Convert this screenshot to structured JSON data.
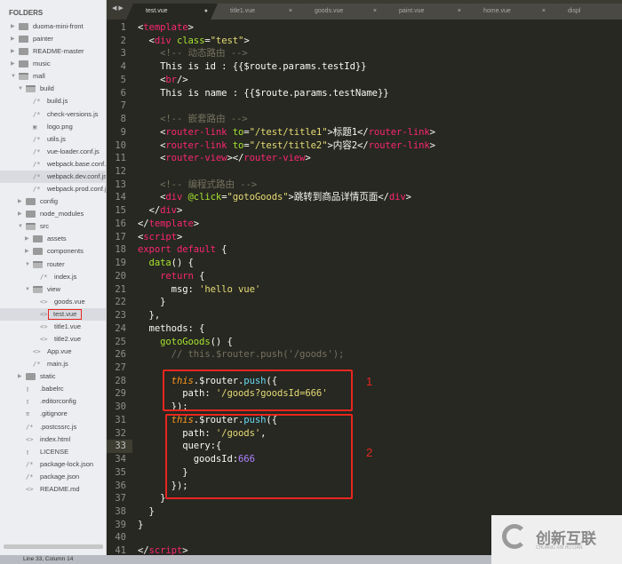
{
  "sidebar": {
    "title": "FOLDERS",
    "items": [
      {
        "depth": 0,
        "type": "folder-closed",
        "label": "duoma-mini-front"
      },
      {
        "depth": 0,
        "type": "folder-closed",
        "label": "painter"
      },
      {
        "depth": 0,
        "type": "folder-closed",
        "label": "README-master"
      },
      {
        "depth": 0,
        "type": "folder-closed",
        "label": "music"
      },
      {
        "depth": 0,
        "type": "folder-open",
        "label": "mall"
      },
      {
        "depth": 1,
        "type": "folder-open",
        "label": "build"
      },
      {
        "depth": 2,
        "type": "js",
        "label": "build.js"
      },
      {
        "depth": 2,
        "type": "js",
        "label": "check-versions.js"
      },
      {
        "depth": 2,
        "type": "img",
        "label": "logo.png"
      },
      {
        "depth": 2,
        "type": "js",
        "label": "utils.js"
      },
      {
        "depth": 2,
        "type": "js",
        "label": "vue-loader.conf.js"
      },
      {
        "depth": 2,
        "type": "js",
        "label": "webpack.base.conf.js"
      },
      {
        "depth": 2,
        "type": "js",
        "label": "webpack.dev.conf.js",
        "selected": true
      },
      {
        "depth": 2,
        "type": "js",
        "label": "webpack.prod.conf.js"
      },
      {
        "depth": 1,
        "type": "folder-closed",
        "label": "config"
      },
      {
        "depth": 1,
        "type": "folder-closed",
        "label": "node_modules"
      },
      {
        "depth": 1,
        "type": "folder-open",
        "label": "src"
      },
      {
        "depth": 2,
        "type": "folder-closed",
        "label": "assets"
      },
      {
        "depth": 2,
        "type": "folder-closed",
        "label": "components"
      },
      {
        "depth": 2,
        "type": "folder-open",
        "label": "router"
      },
      {
        "depth": 3,
        "type": "js",
        "label": "index.js"
      },
      {
        "depth": 2,
        "type": "folder-open",
        "label": "view"
      },
      {
        "depth": 3,
        "type": "vue",
        "label": "goods.vue"
      },
      {
        "depth": 3,
        "type": "vue",
        "label": "test.vue",
        "selected": true,
        "highlighted": true
      },
      {
        "depth": 3,
        "type": "vue",
        "label": "title1.vue"
      },
      {
        "depth": 3,
        "type": "vue",
        "label": "title2.vue"
      },
      {
        "depth": 2,
        "type": "vue",
        "label": "App.vue"
      },
      {
        "depth": 2,
        "type": "js",
        "label": "main.js"
      },
      {
        "depth": 1,
        "type": "folder-closed",
        "label": "static"
      },
      {
        "depth": 1,
        "type": "file",
        "label": ".babelrc"
      },
      {
        "depth": 1,
        "type": "file",
        "label": ".editorconfig"
      },
      {
        "depth": 1,
        "type": "list",
        "label": ".gitignore"
      },
      {
        "depth": 1,
        "type": "js",
        "label": ".postcssrc.js"
      },
      {
        "depth": 1,
        "type": "vue",
        "label": "index.html"
      },
      {
        "depth": 1,
        "type": "file",
        "label": "LICENSE"
      },
      {
        "depth": 1,
        "type": "js",
        "label": "package-lock.json"
      },
      {
        "depth": 1,
        "type": "js",
        "label": "package.json"
      },
      {
        "depth": 1,
        "type": "vue",
        "label": "README.md"
      }
    ]
  },
  "tabs": [
    {
      "label": "test.vue",
      "active": true,
      "modified": true
    },
    {
      "label": "title1.vue"
    },
    {
      "label": "goods.vue"
    },
    {
      "label": "paint.vue"
    },
    {
      "label": "home.vue"
    },
    {
      "label": "displ"
    }
  ],
  "editor": {
    "current_line": 33,
    "lines": [
      [
        [
          "p",
          "<"
        ],
        [
          "tag",
          "template"
        ],
        [
          "p",
          ">"
        ]
      ],
      [
        [
          "p",
          "  <"
        ],
        [
          "tag",
          "div "
        ],
        [
          "attr",
          "class"
        ],
        [
          "p",
          "="
        ],
        [
          "str",
          "\"test\""
        ],
        [
          "p",
          ">"
        ]
      ],
      [
        [
          "cm",
          "    <!-- 动态路由 -->"
        ]
      ],
      [
        [
          "p",
          "    This is id : {{$route.params.testId}}"
        ]
      ],
      [
        [
          "p",
          "    <"
        ],
        [
          "tag",
          "br"
        ],
        [
          "p",
          "/>"
        ]
      ],
      [
        [
          "p",
          "    This is name : {{$route.params.testName}}"
        ]
      ],
      [],
      [
        [
          "cm",
          "    <!-- 嵌套路由 -->"
        ]
      ],
      [
        [
          "p",
          "    <"
        ],
        [
          "tag",
          "router-link "
        ],
        [
          "attr",
          "to"
        ],
        [
          "p",
          "="
        ],
        [
          "str",
          "\"/test/title1\""
        ],
        [
          "p",
          ">标题1</"
        ],
        [
          "tag",
          "router-link"
        ],
        [
          "p",
          ">"
        ]
      ],
      [
        [
          "p",
          "    <"
        ],
        [
          "tag",
          "router-link "
        ],
        [
          "attr",
          "to"
        ],
        [
          "p",
          "="
        ],
        [
          "str",
          "\"/test/title2\""
        ],
        [
          "p",
          ">内容2</"
        ],
        [
          "tag",
          "router-link"
        ],
        [
          "p",
          ">"
        ]
      ],
      [
        [
          "p",
          "    <"
        ],
        [
          "tag",
          "router-view"
        ],
        [
          "p",
          "></"
        ],
        [
          "tag",
          "router-view"
        ],
        [
          "p",
          ">"
        ]
      ],
      [],
      [
        [
          "cm",
          "    <!-- 编程式路由 -->"
        ]
      ],
      [
        [
          "p",
          "    <"
        ],
        [
          "tag",
          "div "
        ],
        [
          "attr",
          "@click"
        ],
        [
          "p",
          "="
        ],
        [
          "str",
          "\"gotoGoods\""
        ],
        [
          "p",
          ">跳转到商品详情页面</"
        ],
        [
          "tag",
          "div"
        ],
        [
          "p",
          ">"
        ]
      ],
      [
        [
          "p",
          "  </"
        ],
        [
          "tag",
          "div"
        ],
        [
          "p",
          ">"
        ]
      ],
      [
        [
          "p",
          "</"
        ],
        [
          "tag",
          "template"
        ],
        [
          "p",
          ">"
        ]
      ],
      [
        [
          "p",
          "<"
        ],
        [
          "tag",
          "script"
        ],
        [
          "p",
          ">"
        ]
      ],
      [
        [
          "kw",
          "export default "
        ],
        [
          "p",
          "{"
        ]
      ],
      [
        [
          "fn",
          "  data"
        ],
        [
          "p",
          "() {"
        ]
      ],
      [
        [
          "kw",
          "    return "
        ],
        [
          "p",
          "{"
        ]
      ],
      [
        [
          "p",
          "      msg: "
        ],
        [
          "str",
          "'hello vue'"
        ]
      ],
      [
        [
          "p",
          "    }"
        ]
      ],
      [
        [
          "p",
          "  },"
        ]
      ],
      [
        [
          "p",
          "  methods: {"
        ]
      ],
      [
        [
          "fn",
          "    gotoGoods"
        ],
        [
          "p",
          "() {"
        ]
      ],
      [
        [
          "cm",
          "      // this.$router.push('/goods');"
        ]
      ],
      [],
      [
        [
          "this",
          "      this"
        ],
        [
          "p",
          ".$router."
        ],
        [
          "sup",
          "push"
        ],
        [
          "p",
          "({"
        ]
      ],
      [
        [
          "p",
          "        path: "
        ],
        [
          "str",
          "'/goods?goodsId=666'"
        ]
      ],
      [
        [
          "p",
          "      });"
        ]
      ],
      [
        [
          "this",
          "      this"
        ],
        [
          "p",
          ".$router."
        ],
        [
          "sup",
          "push"
        ],
        [
          "p",
          "({"
        ]
      ],
      [
        [
          "p",
          "        path: "
        ],
        [
          "str",
          "'/goods'"
        ],
        [
          "p",
          ","
        ]
      ],
      [
        [
          "p",
          "        query:{"
        ]
      ],
      [
        [
          "p",
          "          goodsId:"
        ],
        [
          "num",
          "666"
        ]
      ],
      [
        [
          "p",
          "        }"
        ]
      ],
      [
        [
          "p",
          "      });"
        ]
      ],
      [
        [
          "p",
          "    }"
        ]
      ],
      [
        [
          "p",
          "  }"
        ]
      ],
      [
        [
          "p",
          "}"
        ]
      ],
      [],
      [
        [
          "p",
          "</"
        ],
        [
          "tag",
          "script"
        ],
        [
          "p",
          ">"
        ]
      ]
    ]
  },
  "annotations": {
    "box1_label": "1",
    "box2_label": "2",
    "color": "#e8261f"
  },
  "statusbar": {
    "text": "Line 33, Column 14"
  },
  "watermark": {
    "text": "创新互联",
    "sub": "CHUANG XIN HU LIAN"
  }
}
